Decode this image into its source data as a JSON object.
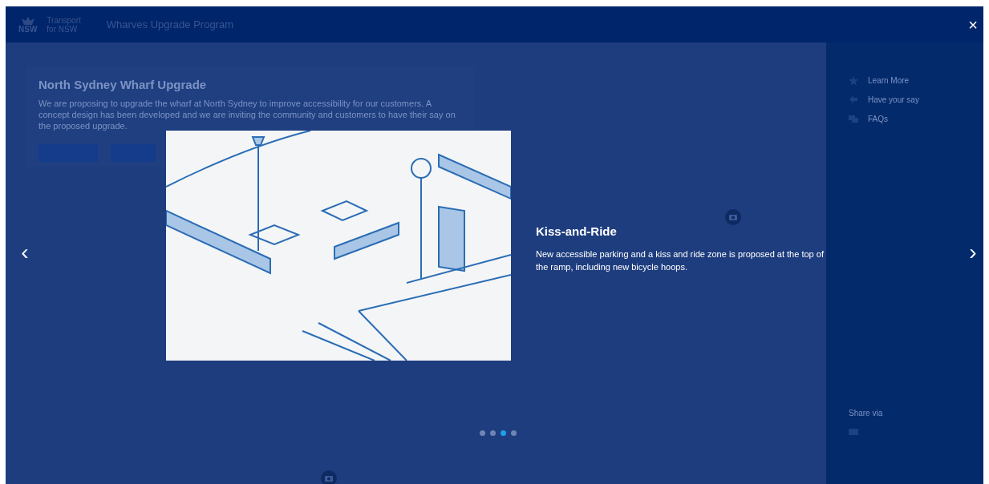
{
  "header": {
    "logo_lines": [
      "Transport",
      "for NSW"
    ],
    "logo_mark": "NSW",
    "title": "Wharves Upgrade Program"
  },
  "page": {
    "heading": "North Sydney Wharf Upgrade",
    "body": "We are proposing to upgrade the wharf at North Sydney to improve accessibility for our customers. A concept design has been developed and we are inviting the community and customers to have their say on the proposed upgrade."
  },
  "sidebar": {
    "items": [
      {
        "kind": "star",
        "label": "Learn More"
      },
      {
        "kind": "arrows",
        "label": "Have your say"
      },
      {
        "kind": "chat",
        "label": "FAQs"
      }
    ],
    "share_label": "Share via"
  },
  "lightbox": {
    "close": "×",
    "prev": "‹",
    "next": "›",
    "caption": {
      "title": "Kiss-and-Ride",
      "text": "New accessible parking and a kiss and ride zone is proposed at the top of the ramp, including new bicycle hoops."
    },
    "slides": [
      {
        "selected": false
      },
      {
        "selected": false
      },
      {
        "selected": true
      },
      {
        "selected": false
      }
    ]
  }
}
